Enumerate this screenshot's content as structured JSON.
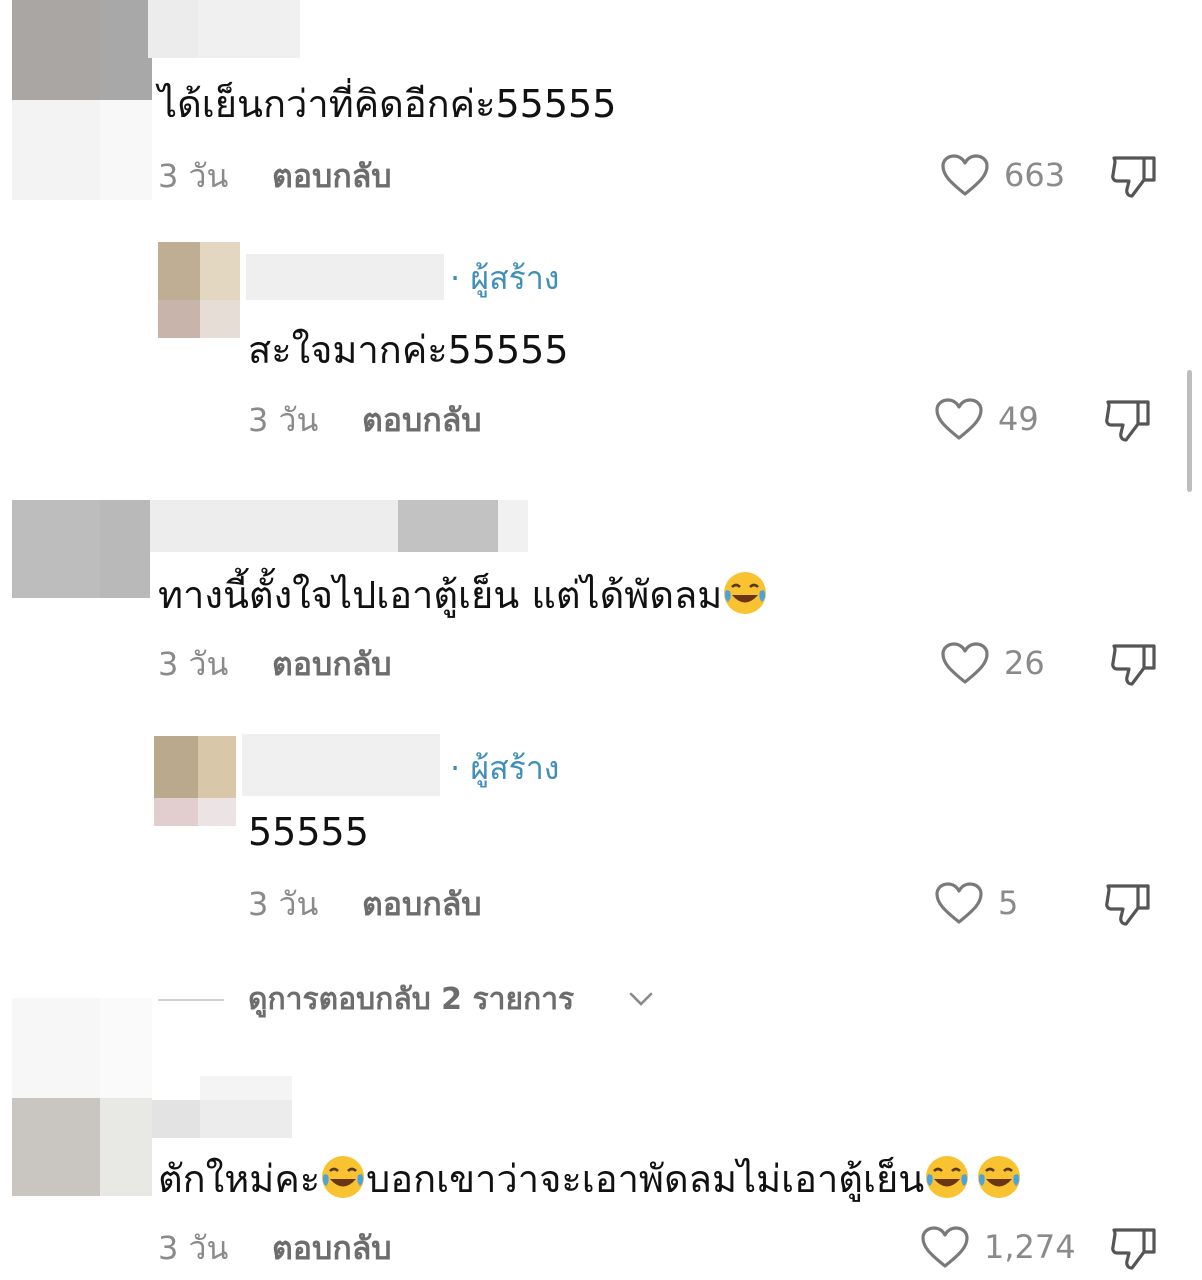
{
  "comments": [
    {
      "text": "ได้เย็นกว่าที่คิดอีกค่ะ55555",
      "time": "3 วัน",
      "reply_label": "ตอบกลับ",
      "likes": "663"
    },
    {
      "creator_label": "· ผู้สร้าง",
      "text": "สะใจมากค่ะ55555",
      "time": "3 วัน",
      "reply_label": "ตอบกลับ",
      "likes": "49"
    },
    {
      "text": "ทางนี้ตั้งใจไปเอาตู้เย็น แต่ได้พัดลม",
      "time": "3 วัน",
      "reply_label": "ตอบกลับ",
      "likes": "26"
    },
    {
      "creator_label": "· ผู้สร้าง",
      "text": "55555",
      "time": "3 วัน",
      "reply_label": "ตอบกลับ",
      "likes": "5"
    },
    {
      "text_a": "ตักใหม่คะ",
      "text_b": "บอกเขาว่าจะเอาพัดลมไม่เอาตู้เย็น",
      "time": "3 วัน",
      "reply_label": "ตอบกลับ",
      "likes": "1,274"
    }
  ],
  "view_replies": "ดูการตอบกลับ 2 รายการ",
  "icons": {
    "like": "heart-icon",
    "dislike": "thumbs-down-icon",
    "emoji": "face-with-tears-of-joy",
    "expand": "chevron-down-icon"
  },
  "colors": {
    "creator_tag": "#3f8fb9",
    "meta_text": "#8a8a8a"
  }
}
